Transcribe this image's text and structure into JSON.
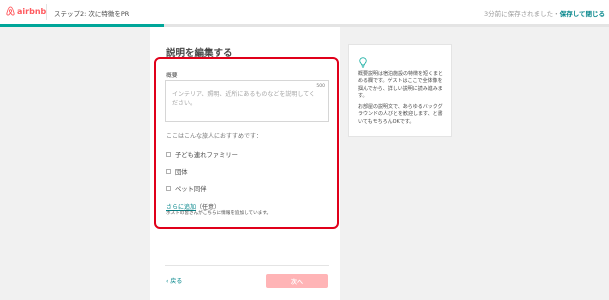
{
  "header": {
    "logo_text": "airbnb",
    "step_title": "ステップ2: 次に特徴をPR",
    "saved_status": "3分前に保存されました・",
    "save_exit": "保存して閉じる"
  },
  "progress": {
    "fraction": 0.27
  },
  "colors": {
    "brand": "#ff5a5f",
    "accent": "#008489",
    "progress": "#00a699",
    "highlight_box": "#e0001a",
    "next_disabled": "#ffb4b6"
  },
  "main": {
    "title": "説明を編集する",
    "summary_label": "概要",
    "summary_placeholder": "インテリア、照明、近所にあるものなどを説明してください。",
    "char_counter": "500",
    "recommend_label": "ここはこんな旅人におすすめです：",
    "options": [
      {
        "label": "子ども連れファミリー",
        "checked": false
      },
      {
        "label": "団体",
        "checked": false
      },
      {
        "label": "ペット同伴",
        "checked": false
      }
    ],
    "add_more_link": "さらに追加",
    "add_more_optional": "（任意）",
    "add_more_note": "ホストの皆さんがこちらに情報を追加しています。",
    "back_label": "‹ 戻る",
    "next_label": "次へ"
  },
  "tip": {
    "icon": "lightbulb-icon",
    "paragraph1": "概要説明は宿泊施設の特徴を短くまとめる欄です。ゲストはここで全体像を掴んでから、詳しい説明に読み進みます。",
    "paragraph2": "お部屋の説明文で、あらゆるバックグラウンドの人びとを歓迎します、と書いてもモちろんOKです。"
  }
}
